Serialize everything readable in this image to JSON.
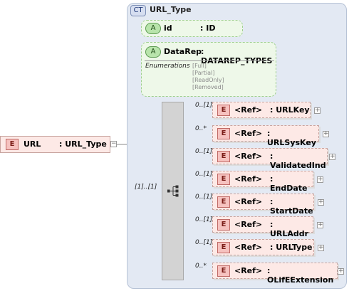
{
  "complex_type": {
    "badge": "CT",
    "name": "URL_Type"
  },
  "root_element": {
    "badge": "E",
    "name": "URL",
    "type": ": URL_Type"
  },
  "attributes": [
    {
      "badge": "A",
      "name": "id",
      "type": ": ID"
    },
    {
      "badge": "A",
      "name": "DataRep",
      "type": ": DATAREP_TYPES",
      "enumerations_label": "Enumerations",
      "enumerations": [
        "[Full]",
        "[Partial]",
        "[ReadOnly]",
        "[Removed]"
      ]
    }
  ],
  "sequence": {
    "cardinality": "[1]..[1]"
  },
  "elements": [
    {
      "badge": "E",
      "cardinality": "0..[1]",
      "ref": "<Ref>",
      "type": ": URLKey"
    },
    {
      "badge": "E",
      "cardinality": "0..*",
      "ref": "<Ref>",
      "type": ": URLSysKey"
    },
    {
      "badge": "E",
      "cardinality": "0..[1]",
      "ref": "<Ref>",
      "type": ": ValidatedInd"
    },
    {
      "badge": "E",
      "cardinality": "0..[1]",
      "ref": "<Ref>",
      "type": ": EndDate"
    },
    {
      "badge": "E",
      "cardinality": "0..[1]",
      "ref": "<Ref>",
      "type": ": StartDate"
    },
    {
      "badge": "E",
      "cardinality": "0..[1]",
      "ref": "<Ref>",
      "type": ": URLAddr"
    },
    {
      "badge": "E",
      "cardinality": "0..[1]",
      "ref": "<Ref>",
      "type": ": URLType"
    },
    {
      "badge": "E",
      "cardinality": "0..*",
      "ref": "<Ref>",
      "type": ": OLifEExtension"
    }
  ],
  "colors": {
    "container": "#e3e9f3",
    "attribute": "#eef8e9",
    "element": "#fde9e6",
    "sequence": "#d3d3d3"
  }
}
